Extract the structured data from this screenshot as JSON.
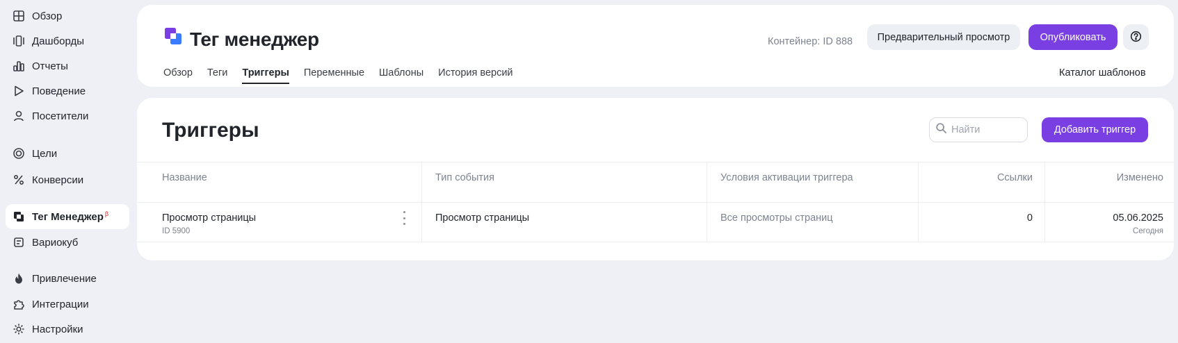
{
  "sidebar": {
    "items": [
      {
        "label": "Обзор",
        "icon": "grid-icon"
      },
      {
        "label": "Дашборды",
        "icon": "dashboards-icon"
      },
      {
        "label": "Отчеты",
        "icon": "bar-chart-icon"
      },
      {
        "label": "Поведение",
        "icon": "play-icon"
      },
      {
        "label": "Посетители",
        "icon": "user-icon"
      },
      {
        "label": "Цели",
        "icon": "target-icon"
      },
      {
        "label": "Конверсии",
        "icon": "percent-icon"
      },
      {
        "label": "Тег Менеджер",
        "icon": "tag-manager-icon",
        "badge": "β",
        "active": true
      },
      {
        "label": "Вариокуб",
        "icon": "variocube-icon"
      },
      {
        "label": "Привлечение",
        "icon": "flame-icon"
      },
      {
        "label": "Интеграции",
        "icon": "puzzle-icon"
      },
      {
        "label": "Настройки",
        "icon": "gear-icon"
      }
    ]
  },
  "header": {
    "title": "Тег менеджер",
    "container_id": "Контейнер: ID 888",
    "preview_label": "Предварительный просмотр",
    "publish_label": "Опубликовать",
    "tabs": [
      {
        "label": "Обзор"
      },
      {
        "label": "Теги"
      },
      {
        "label": "Триггеры",
        "active": true
      },
      {
        "label": "Переменные"
      },
      {
        "label": "Шаблоны"
      },
      {
        "label": "История версий"
      }
    ],
    "catalog_label": "Каталог шаблонов"
  },
  "main": {
    "title": "Триггеры",
    "search_placeholder": "Найти",
    "add_label": "Добавить триггер",
    "columns": [
      "Название",
      "Тип события",
      "Условия активации триггера",
      "Ссылки",
      "Изменено"
    ],
    "rows": [
      {
        "name": "Просмотр страницы",
        "id": "ID 5900",
        "event_type": "Просмотр страницы",
        "conditions": "Все просмотры страниц",
        "links": "0",
        "modified": "05.06.2025",
        "modified_sub": "Сегодня"
      }
    ]
  },
  "colors": {
    "accent": "#7a3fe3",
    "background": "#eef0f5",
    "logo_blue": "#3a7bff",
    "logo_purple": "#7a3fe3"
  }
}
